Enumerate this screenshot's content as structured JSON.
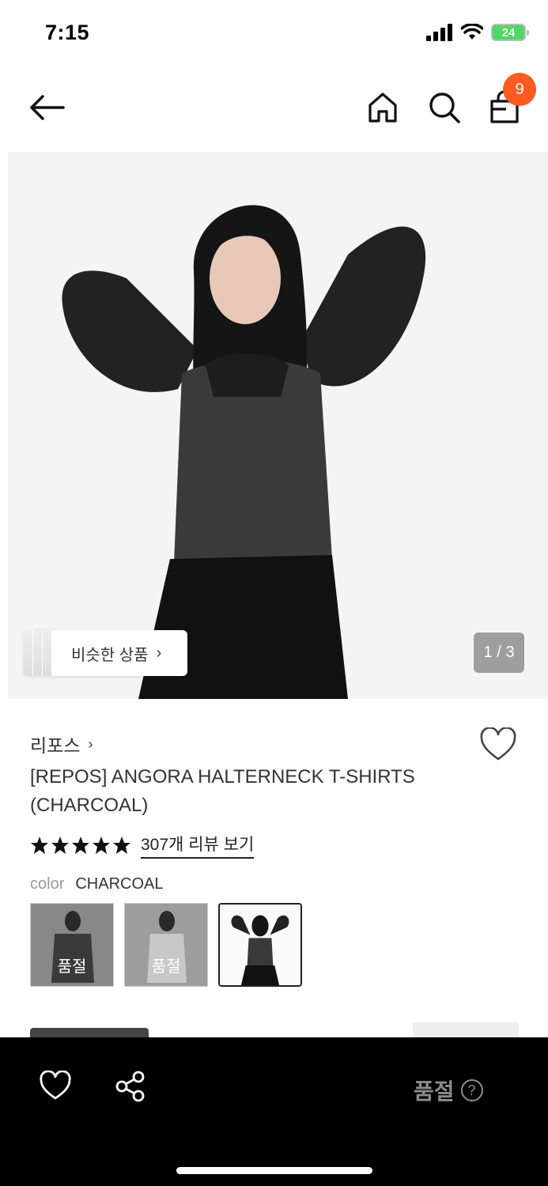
{
  "status": {
    "time": "7:15",
    "battery": "24"
  },
  "nav": {
    "cart_count": "9",
    "icons": [
      "back-arrow-icon",
      "home-icon",
      "search-icon",
      "shopping-bag-icon"
    ]
  },
  "hero": {
    "similar_label": "비슷한 상품",
    "page_counter": "1 / 3"
  },
  "product": {
    "brand": "리포스",
    "title": "[REPOS] ANGORA HALTERNECK T-SHIRTS (CHARCOAL)",
    "rating_stars": 5,
    "reviews_link": "307개 리뷰 보기",
    "color_key": "color",
    "color_value": "CHARCOAL",
    "swatches": [
      {
        "label": "품절",
        "state": "soldout"
      },
      {
        "label": "품절",
        "state": "soldout"
      },
      {
        "label": "",
        "state": "selected"
      }
    ]
  },
  "bottom_bar": {
    "soldout_label": "품절",
    "help_icon": "?"
  },
  "colors": {
    "badge": "#ff5a1f",
    "bottom_bar": "#000000",
    "battery": "#4cd964"
  }
}
